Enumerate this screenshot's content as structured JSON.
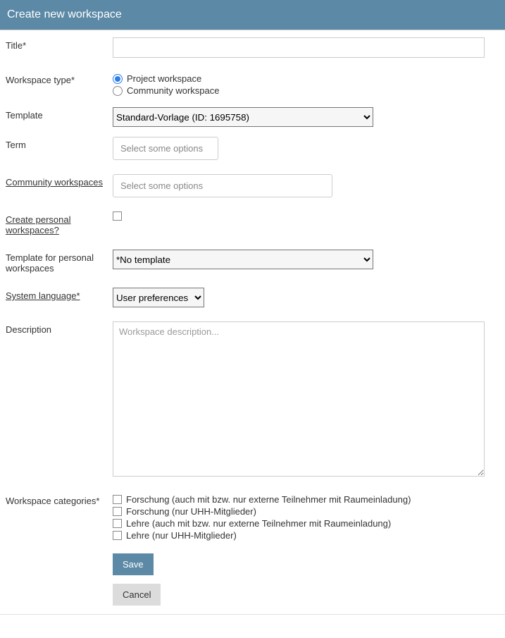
{
  "header": {
    "title": "Create new workspace"
  },
  "fields": {
    "title": {
      "label": "Title*",
      "value": ""
    },
    "workspaceType": {
      "label": "Workspace type*",
      "options": [
        {
          "label": "Project workspace",
          "selected": true
        },
        {
          "label": "Community workspace",
          "selected": false
        }
      ]
    },
    "template": {
      "label": "Template",
      "selected": "Standard-Vorlage (ID: 1695758)"
    },
    "term": {
      "label": "Term",
      "placeholder": "Select some options"
    },
    "communityWorkspaces": {
      "label": "Community workspaces",
      "placeholder": "Select some options"
    },
    "createPersonal": {
      "label": "Create personal workspaces?",
      "checked": false
    },
    "personalTemplate": {
      "label": "Template for personal workspaces",
      "selected": "*No template"
    },
    "systemLanguage": {
      "label": "System language*",
      "selected": "User preferences"
    },
    "description": {
      "label": "Description",
      "placeholder": "Workspace description...",
      "value": ""
    },
    "categories": {
      "label": "Workspace categories*",
      "items": [
        "Forschung (auch mit bzw. nur externe Teilnehmer mit Raumeinladung)",
        "Forschung (nur UHH-Mitglieder)",
        "Lehre (auch mit bzw. nur externe Teilnehmer mit Raumeinladung)",
        "Lehre (nur UHH-Mitglieder)"
      ]
    }
  },
  "buttons": {
    "save": "Save",
    "cancel": "Cancel"
  }
}
